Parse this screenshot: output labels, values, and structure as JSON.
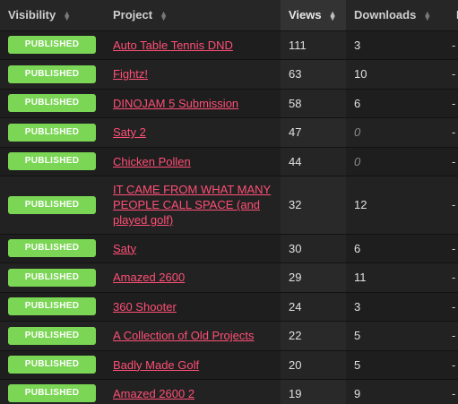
{
  "header": {
    "visibility": "Visibility",
    "project": "Project",
    "views": "Views",
    "downloads": "Downloads",
    "extra": "R"
  },
  "rows": [
    {
      "status": "PUBLISHED",
      "project": "Auto Table Tennis DND",
      "views": "111",
      "downloads": "3",
      "extra": "-"
    },
    {
      "status": "PUBLISHED",
      "project": "Fightz!",
      "views": "63",
      "downloads": "10",
      "extra": "-"
    },
    {
      "status": "PUBLISHED",
      "project": "DINOJAM 5 Submission",
      "views": "58",
      "downloads": "6",
      "extra": "-"
    },
    {
      "status": "PUBLISHED",
      "project": "Saty 2",
      "views": "47",
      "downloads": "0",
      "extra": "-"
    },
    {
      "status": "PUBLISHED",
      "project": "Chicken Pollen",
      "views": "44",
      "downloads": "0",
      "extra": "-"
    },
    {
      "status": "PUBLISHED",
      "project": "IT CAME FROM WHAT MANY PEOPLE CALL SPACE (and played golf)",
      "views": "32",
      "downloads": "12",
      "extra": "-"
    },
    {
      "status": "PUBLISHED",
      "project": "Saty",
      "views": "30",
      "downloads": "6",
      "extra": "-"
    },
    {
      "status": "PUBLISHED",
      "project": "Amazed 2600",
      "views": "29",
      "downloads": "11",
      "extra": "-"
    },
    {
      "status": "PUBLISHED",
      "project": "360 Shooter",
      "views": "24",
      "downloads": "3",
      "extra": "-"
    },
    {
      "status": "PUBLISHED",
      "project": "A Collection of Old Projects",
      "views": "22",
      "downloads": "5",
      "extra": "-"
    },
    {
      "status": "PUBLISHED",
      "project": "Badly Made Golf",
      "views": "20",
      "downloads": "5",
      "extra": "-"
    },
    {
      "status": "PUBLISHED",
      "project": "Amazed 2600 2",
      "views": "19",
      "downloads": "9",
      "extra": "-"
    }
  ],
  "colors": {
    "badge": "#7ad654",
    "link": "#ff4f76",
    "background": "#1f1f1f"
  },
  "icons": {
    "sort": "sort-arrows-icon"
  }
}
